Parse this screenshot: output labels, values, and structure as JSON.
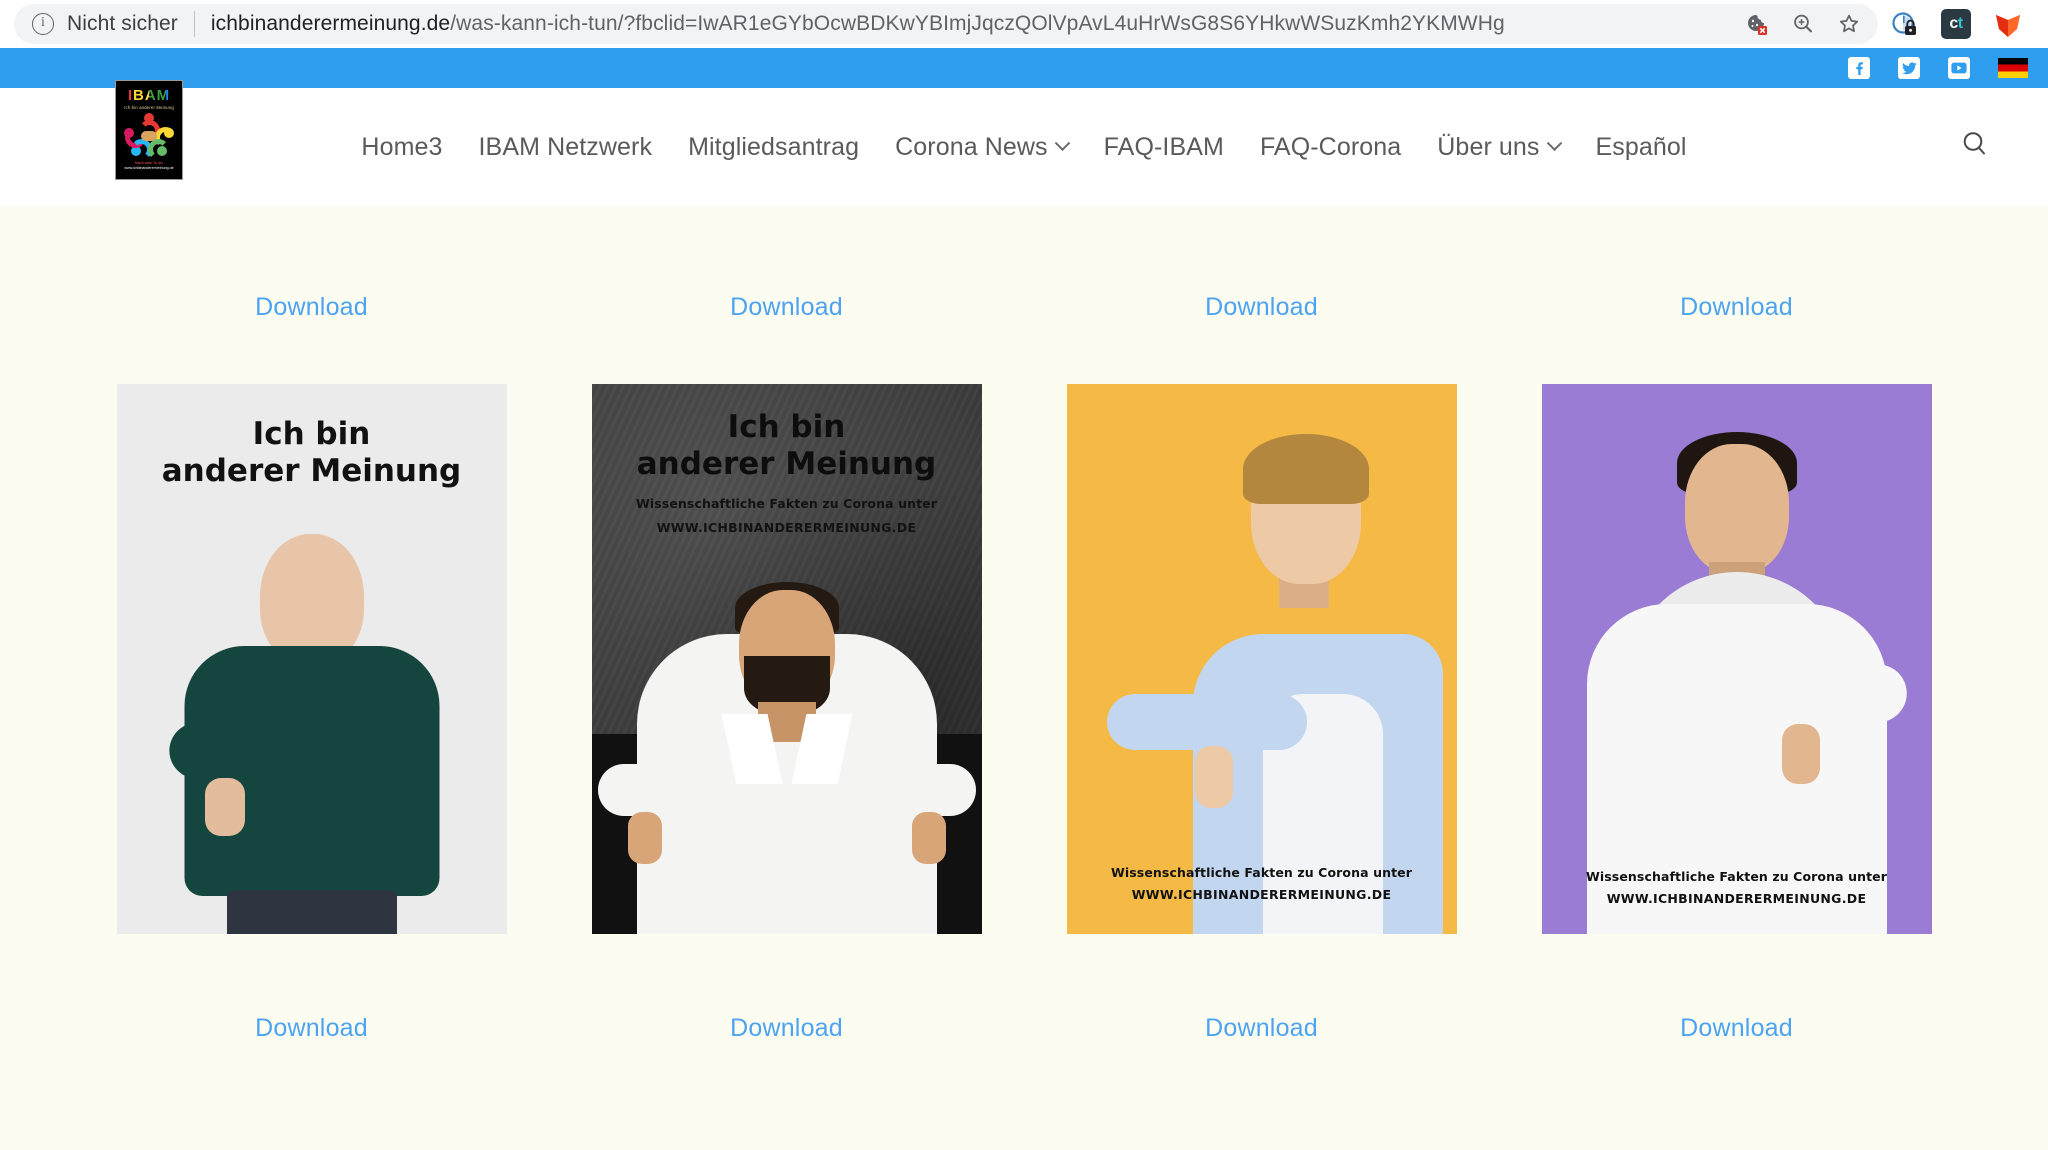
{
  "browser": {
    "security_label": "Nicht sicher",
    "url_host": "ichbinanderermeinung.de",
    "url_path": "/was-kann-ich-tun/?fbclid=IwAR1eGYbOcwBDKwYBImjJqczQOlVpAvL4uHrWsG8S6YHkwWSuzKmh2YKMWHg",
    "icons": {
      "info": "info-circle-icon",
      "cookie_blocked": "cookie-blocked-icon",
      "zoom": "zoom-magnifier-icon",
      "bookmark": "bookmark-star-icon",
      "privacy_ext": "privacy-lock-extension-icon",
      "ct_ext": "ct-extension-icon",
      "shield_ext": "malware-shield-extension-icon"
    },
    "ct_label_left": "c",
    "ct_label_right": "t"
  },
  "topbar": {
    "social": [
      {
        "name": "facebook",
        "glyph": "f"
      },
      {
        "name": "twitter",
        "glyph": "ᵛ"
      },
      {
        "name": "youtube",
        "glyph": "▶"
      }
    ],
    "language_flag": "Deutsch"
  },
  "header": {
    "logo": {
      "title": "IBAM",
      "subtitle": "Ich bin anderer Meinung",
      "footer_red": "Mach was! Tu es!",
      "footer_white": "www.ichbinanderermeinung.de"
    },
    "nav": [
      {
        "label": "Home3",
        "dropdown": false
      },
      {
        "label": "IBAM Netzwerk",
        "dropdown": false
      },
      {
        "label": "Mitgliedsantrag",
        "dropdown": false
      },
      {
        "label": "Corona News",
        "dropdown": true
      },
      {
        "label": "FAQ-IBAM",
        "dropdown": false
      },
      {
        "label": "FAQ-Corona",
        "dropdown": false
      },
      {
        "label": "Über uns",
        "dropdown": true
      },
      {
        "label": "Español",
        "dropdown": false
      }
    ],
    "search_icon": "search-icon"
  },
  "main": {
    "download_label": "Download",
    "poster_title_line1": "Ich bin",
    "poster_title_line2": "anderer Meinung",
    "poster_sub1": "Wissenschaftliche Fakten zu Corona unter",
    "poster_sub2": "WWW.ICHBINANDERERMEINUNG.DE",
    "posters": [
      {
        "id": "poster-woman-green",
        "background": "#ebebeb",
        "has_title": true,
        "has_subtext": false,
        "alt": "Frau in dunkelgrünem Pullover mit Daumen nach unten"
      },
      {
        "id": "poster-man-beard-dark",
        "background": "#3a3a3a",
        "has_title": true,
        "has_subtext": true,
        "alt": "Bärtiger Mann im weißen Hemd mit beiden Daumen nach unten"
      },
      {
        "id": "poster-boy-yellow",
        "background": "#f5b945",
        "has_title": false,
        "has_subtext": true,
        "alt": "Junge im hellblauen Hemd mit Daumen nach unten"
      },
      {
        "id": "poster-man-hoodie-purple",
        "background": "#9a7cd4",
        "has_title": false,
        "has_subtext": true,
        "alt": "Mann im weißen Hoodie mit Daumen nach unten"
      }
    ]
  },
  "colors": {
    "accent_blue": "#2f9eee",
    "link_blue": "#4ba3f2",
    "page_background": "#fdfcf0",
    "nav_text": "#5a5a5a"
  }
}
